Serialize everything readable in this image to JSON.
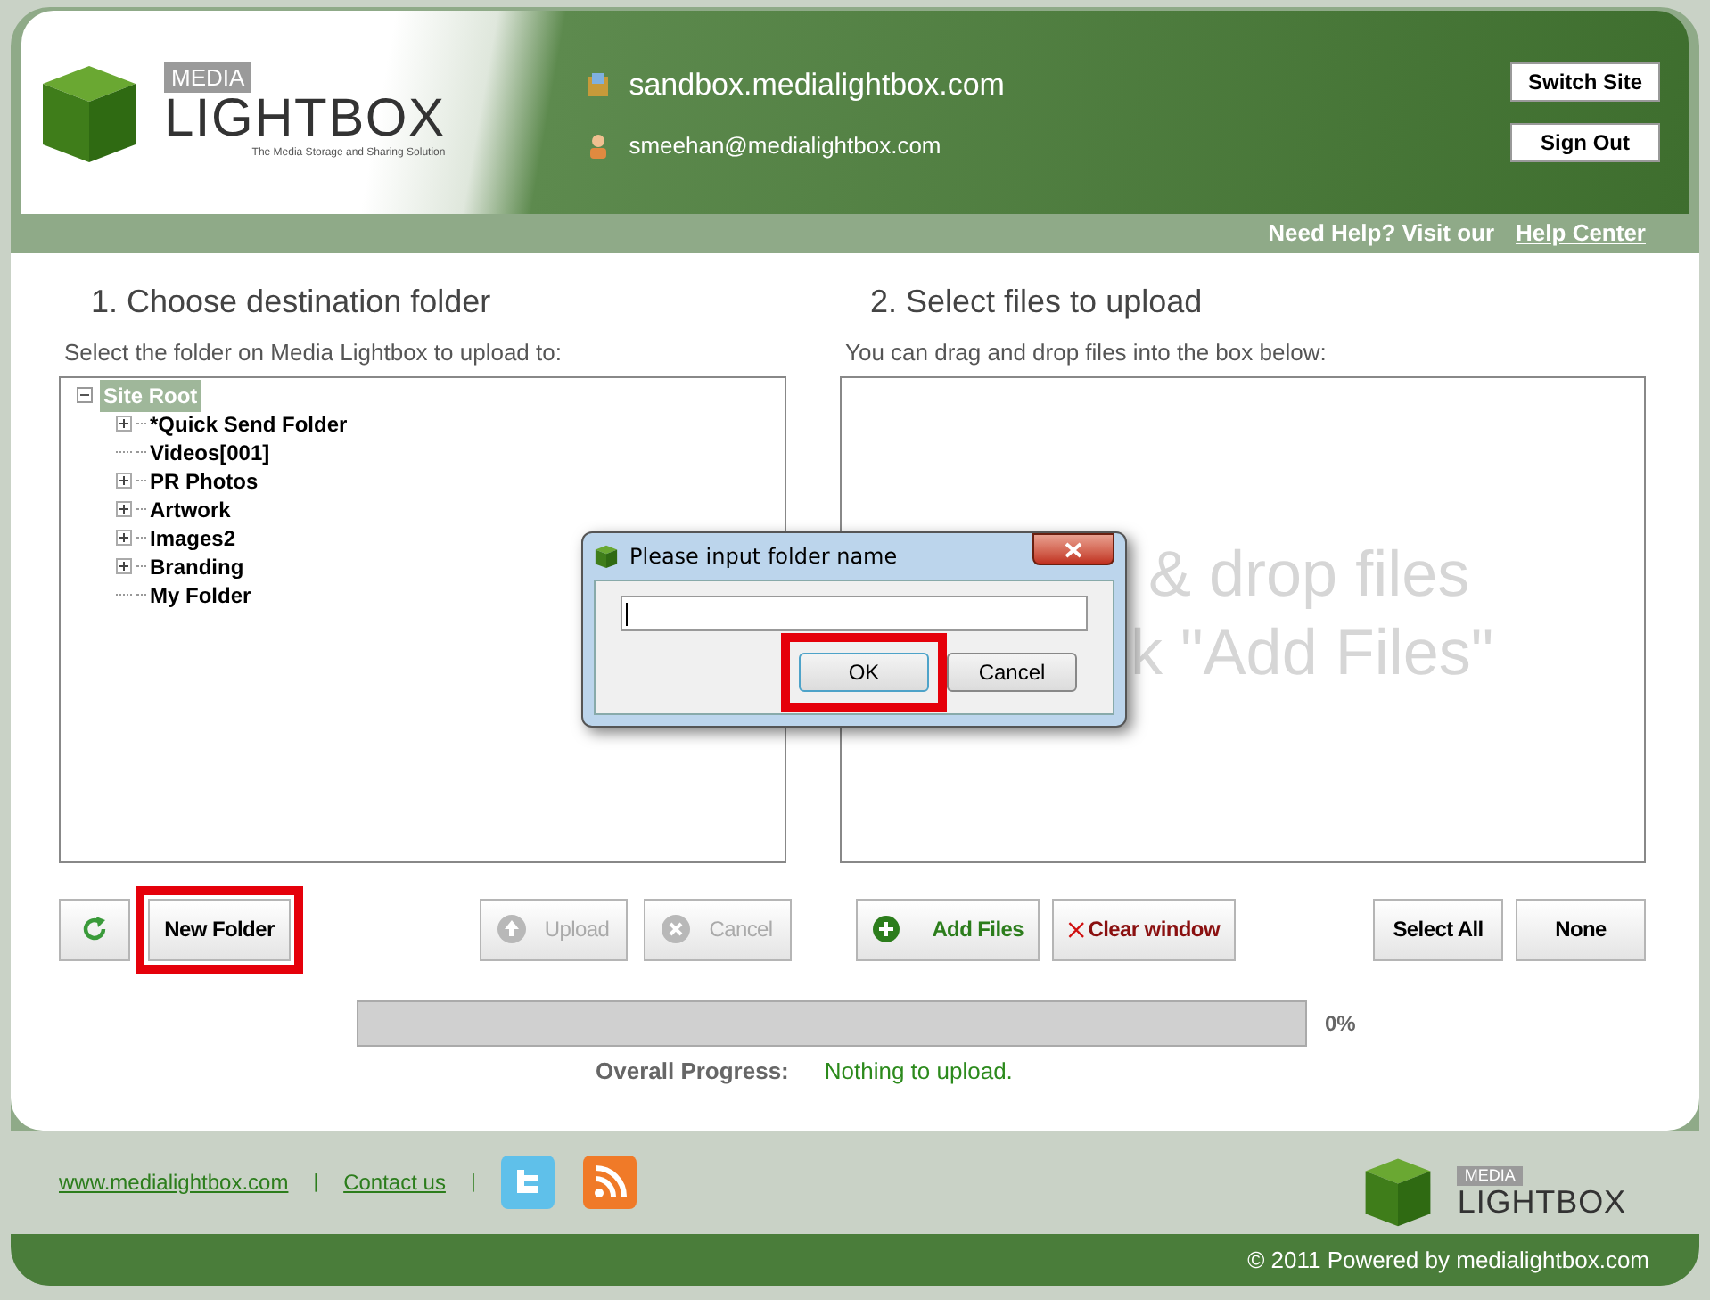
{
  "header": {
    "logo": {
      "top": "MEDIA",
      "main": "LIGHTBOX",
      "tagline": "The Media Storage and Sharing Solution"
    },
    "site": "sandbox.medialightbox.com",
    "user": "smeehan@medialightbox.com",
    "buttons": [
      "Switch Site",
      "Sign Out"
    ]
  },
  "help_bar": {
    "text": "Need Help? Visit our",
    "link": "Help Center"
  },
  "left": {
    "heading": "1. Choose destination folder",
    "hint": "Select the folder on Media Lightbox to upload to:",
    "tree": {
      "label": "Site Root",
      "expanded": true,
      "selected": true,
      "children": [
        {
          "label": "*Quick Send Folder",
          "has_children": true
        },
        {
          "label": "Videos[001]",
          "has_children": false
        },
        {
          "label": "PR Photos",
          "has_children": true
        },
        {
          "label": "Artwork",
          "has_children": true
        },
        {
          "label": "Images2",
          "has_children": true
        },
        {
          "label": "Branding",
          "has_children": true
        },
        {
          "label": "My Folder",
          "has_children": false
        }
      ]
    },
    "buttons": [
      {
        "kind": "refresh",
        "disabled": false,
        "highlighted": false
      },
      {
        "kind": "text",
        "label": "New Folder",
        "disabled": false,
        "highlighted": true
      },
      {
        "kind": "upload",
        "label": "Upload",
        "disabled": true,
        "highlighted": false
      },
      {
        "kind": "cancel",
        "label": "Cancel",
        "disabled": true,
        "highlighted": false
      }
    ]
  },
  "right": {
    "heading": "2. Select files to upload",
    "hint": "You can drag and drop files into the box below:",
    "drop_lines": [
      "& drop files",
      "k \"Add Files\""
    ],
    "buttons": [
      {
        "kind": "add",
        "label": "Add Files",
        "disabled": false
      },
      {
        "kind": "clear",
        "label": "Clear window",
        "disabled": false
      },
      {
        "kind": "text",
        "label": "Select All",
        "disabled": false
      },
      {
        "kind": "text",
        "label": "None",
        "disabled": false
      }
    ]
  },
  "progress": {
    "level": 0,
    "reading": "0%",
    "label": "Overall Progress:",
    "status": "Nothing to upload."
  },
  "footer": {
    "links": [
      "www.medialightbox.com",
      "Contact us"
    ],
    "separators": [
      "|",
      "|"
    ],
    "logo": {
      "top": "MEDIA",
      "main": "LIGHTBOX"
    },
    "copyright": "© 2011 Powered by medialightbox.com"
  },
  "dialog": {
    "title": "Please input folder name",
    "buttons": [
      {
        "label": "OK",
        "highlighted": true
      },
      {
        "label": "Cancel",
        "highlighted": false
      }
    ]
  }
}
